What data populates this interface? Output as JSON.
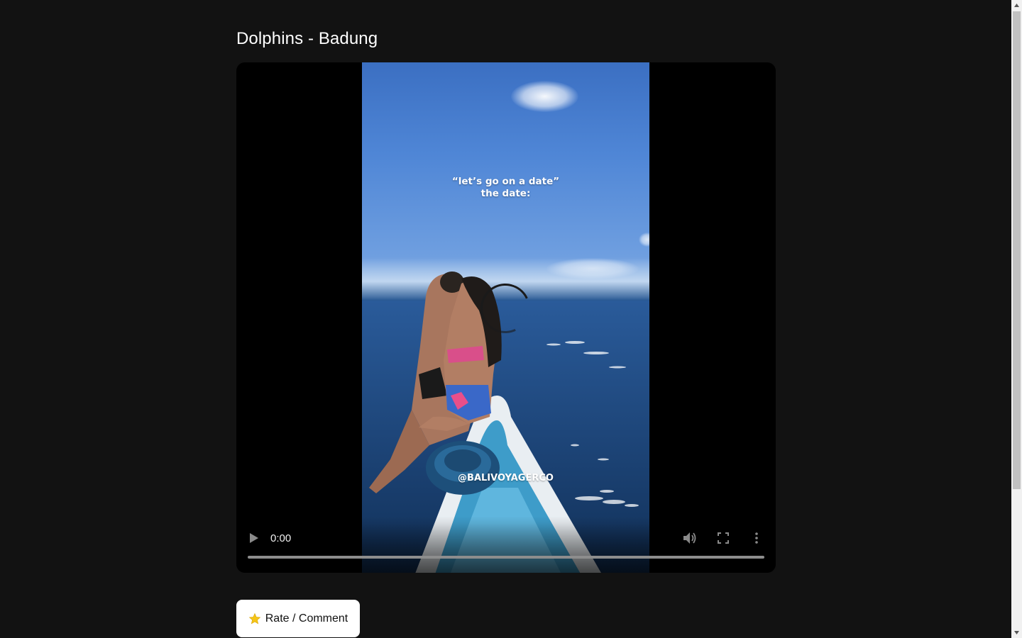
{
  "page": {
    "title": "Dolphins - Badung"
  },
  "video": {
    "overlay_caption_line1": "“let’s go on a date”",
    "overlay_caption_line2": "the date:",
    "watermark": "@BALIVOYAGERCO",
    "current_time": "0:00",
    "progress_fraction": 0,
    "state": "loading"
  },
  "controls": {
    "play_icon": "play-icon",
    "volume_icon": "volume-icon",
    "fullscreen_icon": "fullscreen-icon",
    "more_icon": "more-vertical-icon"
  },
  "actions": {
    "rate_label": "Rate / Comment",
    "rate_icon": "star-icon"
  },
  "colors": {
    "background": "#121212",
    "player_background": "#000000",
    "button_background": "#ffffff",
    "star": "#f5c518"
  }
}
